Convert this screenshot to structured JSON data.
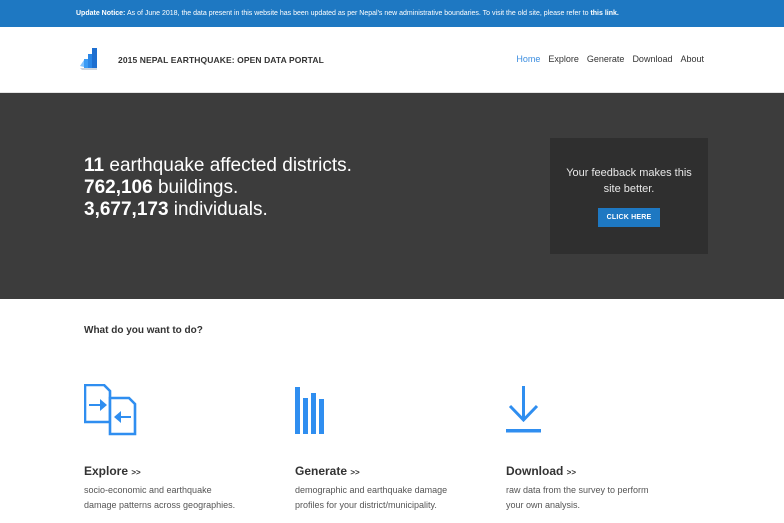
{
  "notice": {
    "label": "Update Notice:",
    "text": " As of June 2018, the data present in this website has been updated as per Nepal's new administrative boundaries. To visit the old site, please refer to ",
    "link": "this link."
  },
  "header": {
    "title": "2015 NEPAL EARTHQUAKE: OPEN DATA PORTAL",
    "logo_icon": "stairs-logo-icon",
    "nav": [
      {
        "label": "Home",
        "active": true
      },
      {
        "label": "Explore",
        "active": false
      },
      {
        "label": "Generate",
        "active": false
      },
      {
        "label": "Download",
        "active": false
      },
      {
        "label": "About",
        "active": false
      }
    ]
  },
  "hero": {
    "lines": [
      {
        "number": "11",
        "text": " earthquake affected districts."
      },
      {
        "number": "762,106",
        "text": " buildings."
      },
      {
        "number": "3,677,173",
        "text": " individuals."
      }
    ],
    "feedback_text": "Your feedback makes this site better.",
    "feedback_button": "CLICK HERE"
  },
  "main": {
    "question": "What do you want to do?",
    "cards": [
      {
        "title": "Explore",
        "arrows": ">>",
        "icon": "explore-icon",
        "description_lines": [
          "socio-economic and earthquake",
          "damage patterns across geographies."
        ]
      },
      {
        "title": "Generate",
        "arrows": ">>",
        "icon": "bar-chart-icon",
        "description_lines": [
          "demographic and earthquake damage",
          "profiles for your district/municipality."
        ]
      },
      {
        "title": "Download",
        "arrows": ">>",
        "icon": "download-icon",
        "description_lines": [
          "raw data from the survey to perform",
          "your own analysis."
        ]
      }
    ]
  },
  "colors": {
    "accent": "#1e78c2",
    "icon_blue": "#2f8ef0",
    "hero_bg": "#3c3c3c",
    "feedback_bg": "#2f2f2f"
  }
}
